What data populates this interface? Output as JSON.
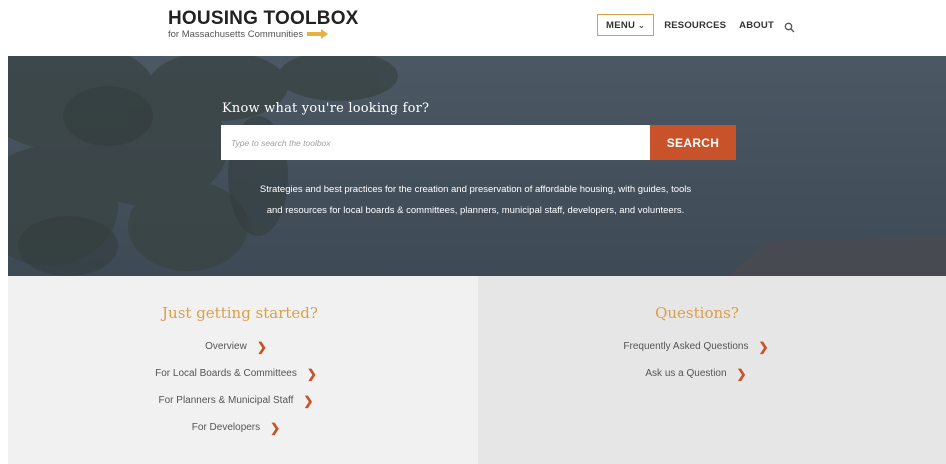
{
  "header": {
    "logo_title": "HOUSING TOOLBOX",
    "logo_subtitle": "for Massachusetts Communities",
    "menu_label": "MENU",
    "resources_label": "RESOURCES",
    "about_label": "ABOUT"
  },
  "hero": {
    "heading": "Know what you're looking for?",
    "search_placeholder": "Type to search the toolbox",
    "search_button": "SEARCH",
    "description_line1": "Strategies and best practices for the creation and preservation of affordable housing, with guides, tools",
    "description_line2": "and resources for local boards & committees, planners, municipal staff, developers, and volunteers."
  },
  "getting_started": {
    "title": "Just getting started?",
    "links": [
      {
        "label": "Overview"
      },
      {
        "label": "For Local Boards & Committees"
      },
      {
        "label": "For Planners & Municipal Staff"
      },
      {
        "label": "For Developers"
      }
    ]
  },
  "questions": {
    "title": "Questions?",
    "links": [
      {
        "label": "Frequently Asked Questions"
      },
      {
        "label": "Ask us a Question"
      }
    ]
  },
  "colors": {
    "accent_orange": "#c8532a",
    "accent_gold": "#d9a04a",
    "hero_bg": "#4a5762"
  },
  "icons": {
    "search": "search-icon",
    "menu_chevron": "chevron-down-icon",
    "link_chevron": "chevron-right-icon",
    "logo_mark": "key-icon"
  }
}
